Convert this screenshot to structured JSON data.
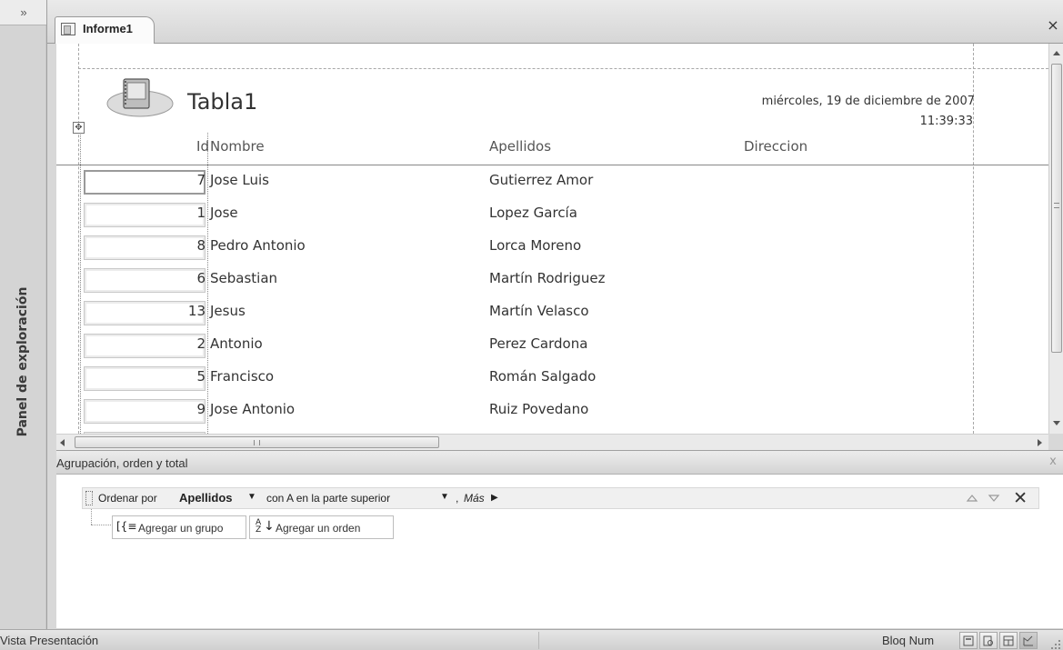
{
  "nav_pane": {
    "toggle": "»",
    "label": "Panel de exploración"
  },
  "document_tab": {
    "label": "Informe1",
    "close": "×"
  },
  "report": {
    "title": "Tabla1",
    "date": "miércoles, 19 de diciembre de 2007",
    "time": "11:39:33",
    "columns": [
      "Id",
      "Nombre",
      "Apellidos",
      "Direccion"
    ],
    "rows": [
      {
        "id": "7",
        "nombre": "Jose Luis",
        "apellidos": "Gutierrez Amor"
      },
      {
        "id": "1",
        "nombre": "Jose",
        "apellidos": "Lopez García"
      },
      {
        "id": "8",
        "nombre": "Pedro Antonio",
        "apellidos": "Lorca Moreno"
      },
      {
        "id": "6",
        "nombre": "Sebastian",
        "apellidos": "Martín Rodriguez"
      },
      {
        "id": "13",
        "nombre": "Jesus",
        "apellidos": "Martín Velasco"
      },
      {
        "id": "2",
        "nombre": "Antonio",
        "apellidos": "Perez Cardona"
      },
      {
        "id": "5",
        "nombre": "Francisco",
        "apellidos": "Román Salgado"
      },
      {
        "id": "9",
        "nombre": "Jose Antonio",
        "apellidos": "Ruiz Povedano"
      }
    ]
  },
  "group_pane": {
    "title": "Agrupación, orden y total",
    "close": "x",
    "sort": {
      "prefix": "Ordenar por",
      "field": "Apellidos",
      "order": "con A en la parte superior",
      "more": "Más",
      "delete": "✕"
    },
    "add_group": "Agregar un grupo",
    "add_sort": "Agregar un orden"
  },
  "status_bar": {
    "view": "Vista Presentación",
    "num_lock": "Bloq Num"
  }
}
